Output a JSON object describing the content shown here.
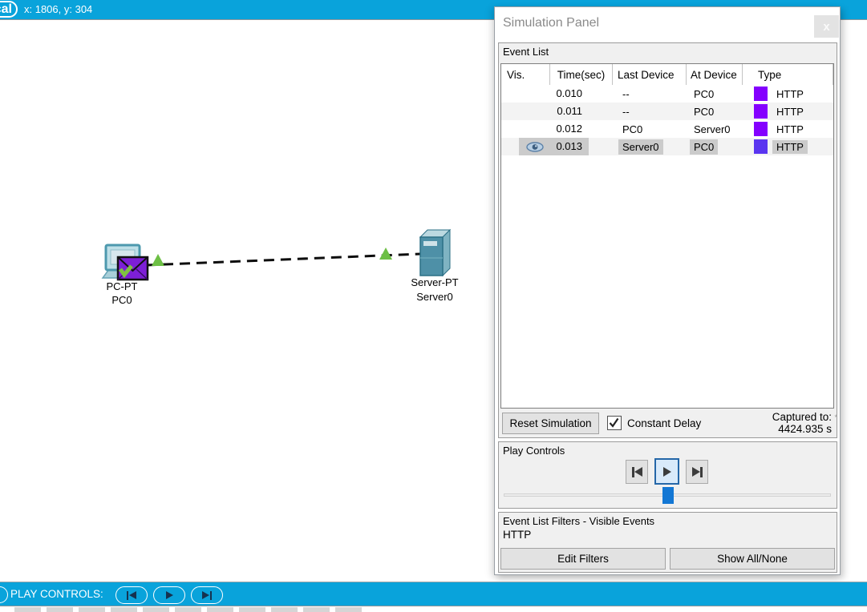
{
  "top_bar": {
    "view_toggle_label": "cal",
    "coordinates": "x: 1806, y: 304"
  },
  "topology": {
    "pc": {
      "model": "PC-PT",
      "name": "PC0"
    },
    "server": {
      "model": "Server-PT",
      "name": "Server0"
    }
  },
  "simulation_panel": {
    "title": "Simulation Panel",
    "close_label": "x",
    "event_list": {
      "label": "Event List",
      "columns": [
        "Vis.",
        "Time(sec)",
        "Last Device",
        "At Device",
        "Type"
      ],
      "rows": [
        {
          "vis": "",
          "time": "0.010",
          "last_device": "--",
          "at_device": "PC0",
          "type": "HTTP",
          "color": "#8400ff"
        },
        {
          "vis": "",
          "time": "0.011",
          "last_device": "--",
          "at_device": "PC0",
          "type": "HTTP",
          "color": "#8400ff"
        },
        {
          "vis": "",
          "time": "0.012",
          "last_device": "PC0",
          "at_device": "Server0",
          "type": "HTTP",
          "color": "#8400ff"
        },
        {
          "vis": "eye",
          "time": "0.013",
          "last_device": "Server0",
          "at_device": "PC0",
          "type": "HTTP",
          "color": "#5a35f0"
        }
      ],
      "reset_button": "Reset Simulation",
      "constant_delay_label": "Constant Delay",
      "constant_delay_checked": true,
      "captured_to_label": "Captured to:",
      "captured_to_value": "4424.935 s"
    },
    "play_controls": {
      "label": "Play Controls"
    },
    "filters": {
      "label": "Event List Filters - Visible Events",
      "visible_events": "HTTP",
      "edit_filters_button": "Edit Filters",
      "show_all_none_button": "Show All/None"
    }
  },
  "bottom_bar": {
    "label": "PLAY CONTROLS:"
  },
  "colors": {
    "accent_blue": "#09a3db",
    "http_purple": "#8400ff",
    "http_selected_purple": "#5a35f0",
    "slider_blue": "#1377d4",
    "triangle_green": "#6dbf45",
    "selection_gray": "#cbcbcb"
  }
}
